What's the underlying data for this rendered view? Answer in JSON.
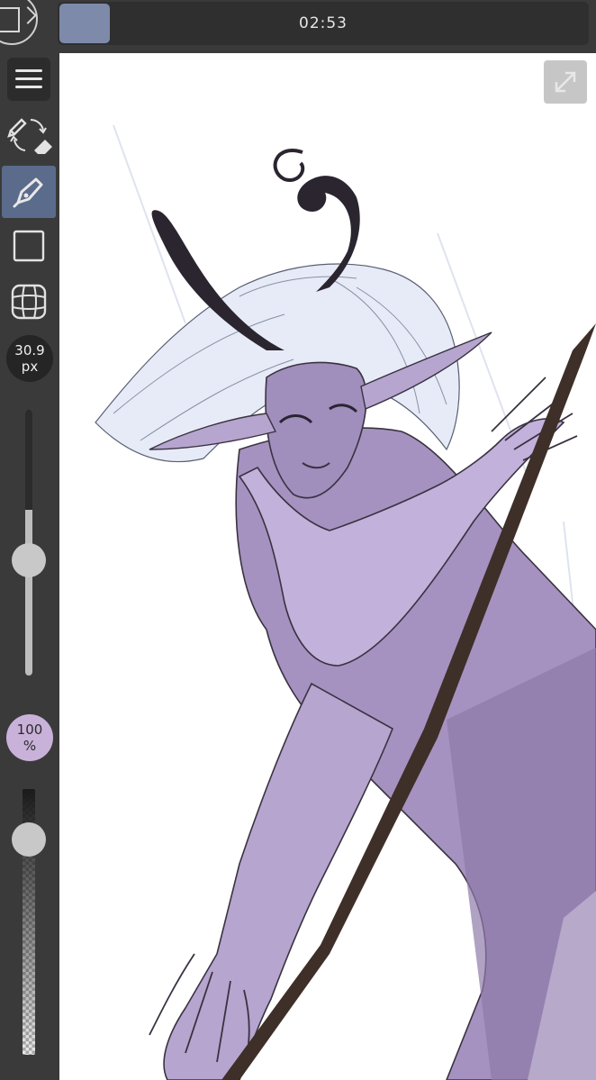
{
  "header": {
    "timer": "02:53",
    "current_color": "#7d8aa9"
  },
  "toolbar": {
    "icons": [
      "menu-icon",
      "pen-eraser-swap-icon",
      "pen-icon",
      "rectangle-select-icon",
      "grid-transform-icon"
    ],
    "active_tool": "pen",
    "brush_size_value": "30.9",
    "brush_size_unit": "px",
    "opacity_value": "100",
    "opacity_unit": "%",
    "brush_size_level": 0.62,
    "opacity_level": 1.0
  },
  "canvas": {
    "background": "#ffffff",
    "expand_icon": "expand-icon"
  },
  "colors": {
    "ui_background": "#3a3a3a",
    "active_tool_highlight": "#5a6b8c",
    "opacity_badge": "#c9b2d9",
    "skin": "#a592c0",
    "hair": "#e6ebf7",
    "horns": "#2b2530",
    "staff": "#3e2f28"
  }
}
